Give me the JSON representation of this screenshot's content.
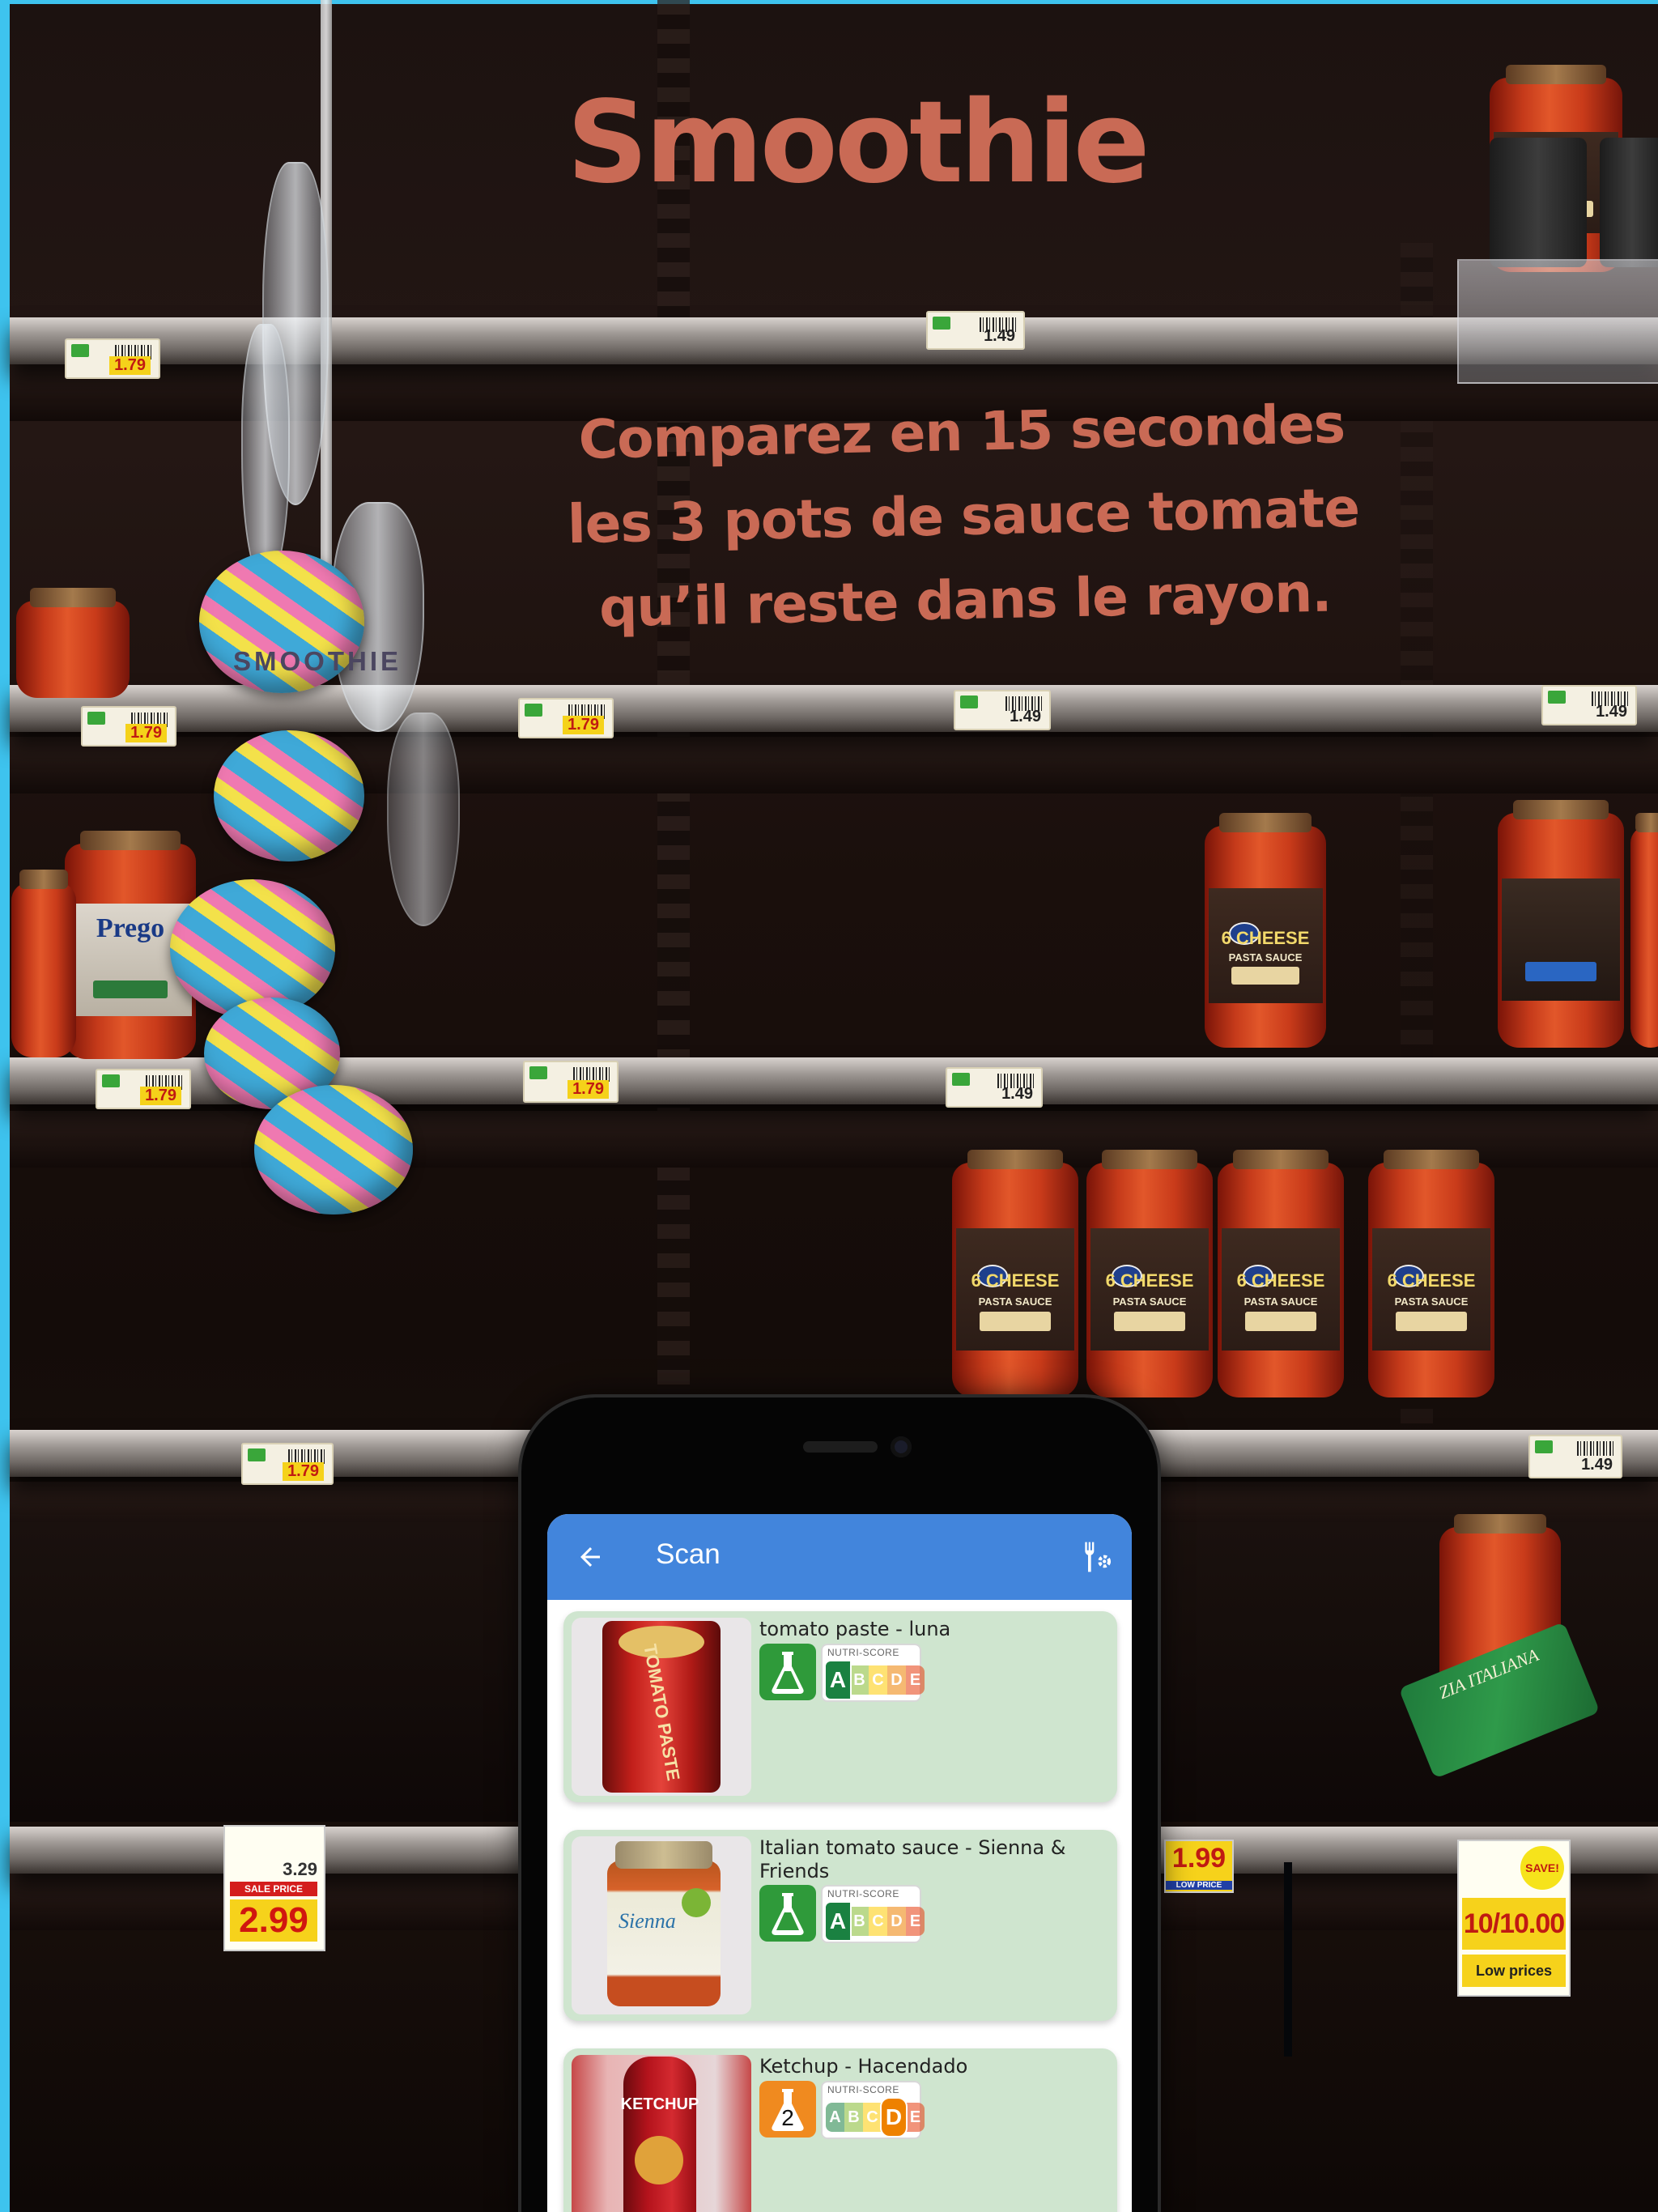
{
  "poster": {
    "title": "Smoothie",
    "subtitle_lines": [
      "Comparez en 15 secondes",
      "les 3 pots de sauce tomate",
      "qu’il reste dans le rayon."
    ],
    "brand_small": "SMOOTHIE",
    "colors": {
      "accent": "#c96a55",
      "edge": "#3ec3ee"
    }
  },
  "background": {
    "price_tags": [
      "1.79",
      "1.49",
      "1.79",
      "1.79",
      "1.49",
      "1.49",
      "1.79",
      "1.79",
      "1.49",
      "1.79",
      "1.49",
      "3.29",
      "1.99"
    ],
    "sale_tag": {
      "header": "SALE PRICE",
      "price": "2.99"
    },
    "low_price_tag": {
      "price": "1.99",
      "caption": "LOW PRICE"
    },
    "promo_tag": {
      "badge": "SAVE!",
      "price": "10/10.00",
      "caption": "Low prices"
    },
    "jar_label_title": "6 CHEESE",
    "jar_label_sub": "PASTA SAUCE",
    "left_jar_label": "Prego",
    "right_jar_label": "ZIA ITALIANA"
  },
  "app": {
    "appbar": {
      "title": "Scan",
      "back_icon": "arrow-left-icon",
      "settings_icon": "utensils-settings-icon",
      "color": "#4285dc"
    },
    "products": [
      {
        "title": "tomato paste - luna",
        "ecoscore": "A",
        "ecoscore_color": "#2f9a3a",
        "nutriscore_label": "NUTRI-SCORE",
        "nutriscore": "A",
        "image_text": "TOMATO PASTE"
      },
      {
        "title": "Italian tomato sauce - Sienna & Friends",
        "ecoscore": "A",
        "ecoscore_color": "#2f9a3a",
        "nutriscore_label": "NUTRI-SCORE",
        "nutriscore": "A",
        "image_text": "Sienna"
      },
      {
        "title": "Ketchup - Hacendado",
        "ecoscore": "2",
        "ecoscore_color": "#f08a1f",
        "nutriscore_label": "NUTRI-SCORE",
        "nutriscore": "D",
        "image_text": "KETCHUP"
      }
    ],
    "card_color": "#cfe5cf"
  }
}
